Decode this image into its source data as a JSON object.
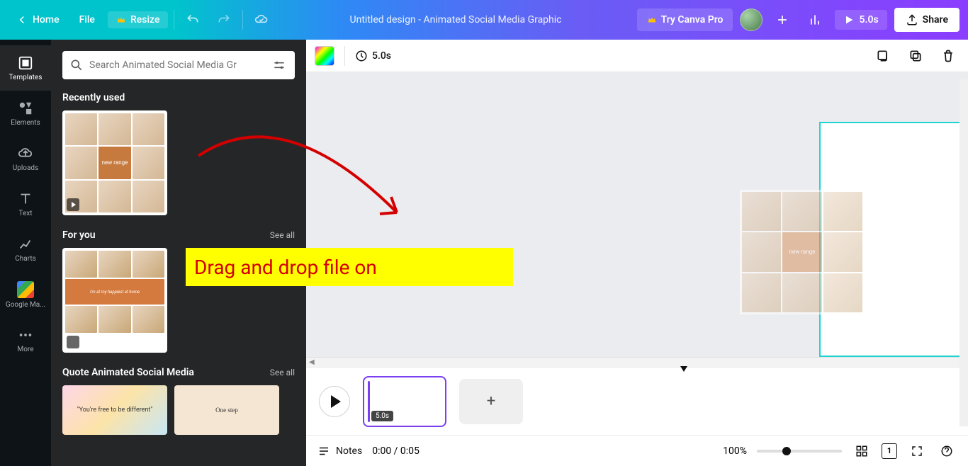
{
  "topbar": {
    "home": "Home",
    "file": "File",
    "resize": "Resize",
    "title": "Untitled design - Animated Social Media Graphic",
    "try_pro": "Try Canva Pro",
    "duration": "5.0s",
    "share": "Share"
  },
  "rail": {
    "templates": "Templates",
    "elements": "Elements",
    "uploads": "Uploads",
    "text": "Text",
    "charts": "Charts",
    "google_maps": "Google Ma...",
    "more": "More"
  },
  "panel": {
    "search_placeholder": "Search Animated Social Media Gr",
    "recently_used": "Recently used",
    "for_you": "For you",
    "see_all": "See all",
    "quote_section": "Quote Animated Social Media",
    "template_tile_text": "new range",
    "foryou_banner": "I'm at my happiest at home",
    "quote1": "\"You're free to be different\"",
    "quote2": "One step"
  },
  "canvas": {
    "color_square_label": "Color",
    "top_duration": "5.0s",
    "drag_tile_text": "new range"
  },
  "timeline": {
    "frame_duration": "5.0s"
  },
  "bottombar": {
    "notes": "Notes",
    "time": "0:00 / 0:05",
    "zoom": "100%",
    "page_count": "1"
  },
  "annotation": {
    "text": "Drag and drop file on"
  }
}
